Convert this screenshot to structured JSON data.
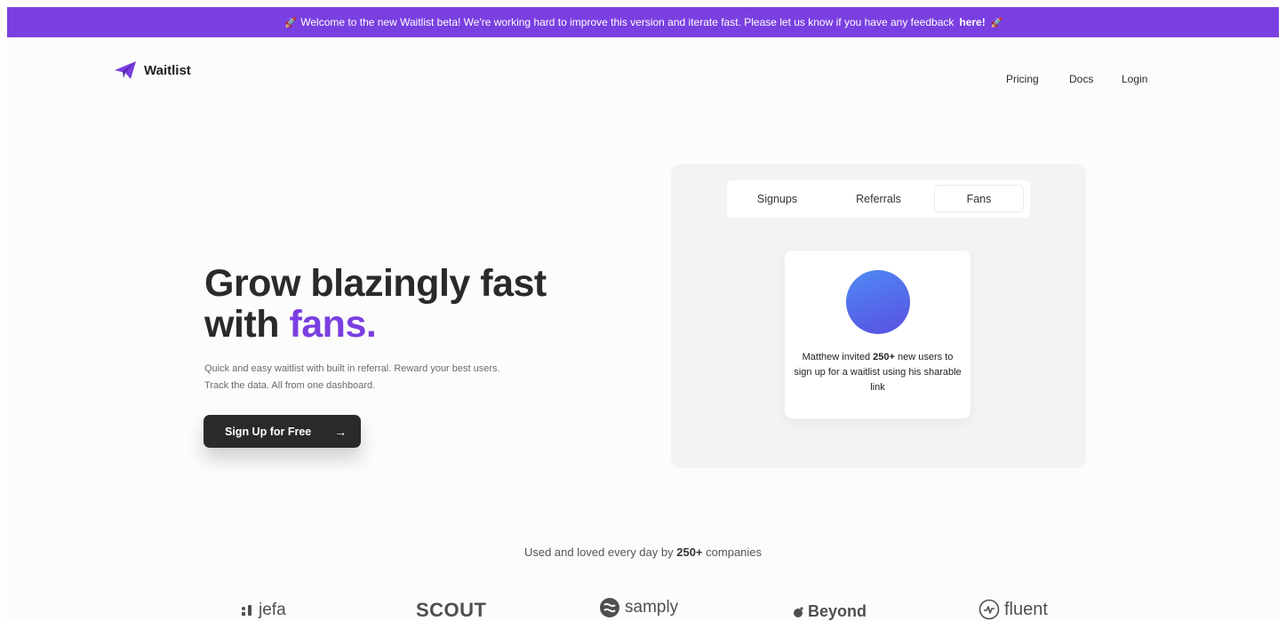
{
  "banner": {
    "emoji_left": "🚀",
    "text": "Welcome to the new Waitlist beta! We're working hard to improve this version and iterate fast. Please let us know if you have any feedback",
    "link_label": "here!",
    "emoji_right": "🚀"
  },
  "header": {
    "logo_icon": "paper-plane-icon",
    "logo_text": "Waitlist",
    "nav": {
      "pricing": "Pricing",
      "docs": "Docs",
      "login": "Login"
    }
  },
  "hero": {
    "title_line1": "Grow blazingly fast",
    "title_line2_prefix": "with",
    "title_line2_accent": "fans.",
    "subtitle_line1": "Quick and easy waitlist with built in referral. Reward your best users.",
    "subtitle_line2": "Track the data. All from one dashboard.",
    "cta_label": "Sign Up for Free",
    "cta_icon": "arrow-right-icon"
  },
  "panel": {
    "tabs": [
      "Signups",
      "Referrals",
      "Fans"
    ],
    "active_tab": "Fans",
    "card": {
      "text_prefix": "Matthew invited",
      "highlight": "250+",
      "text_suffix": "new users to sign up for a waitlist using his sharable link"
    }
  },
  "companies": {
    "line_prefix": "Used and loved every day by",
    "highlight": "250+",
    "line_suffix": "companies",
    "logos": [
      "jefa",
      "SCOUT",
      "samply",
      "Beyond",
      "fluent"
    ]
  },
  "colors": {
    "brand": "#7a3fe0",
    "cta": "#2b2a29",
    "avatar_from": "#4e8af5",
    "avatar_to": "#5a4fe0"
  }
}
